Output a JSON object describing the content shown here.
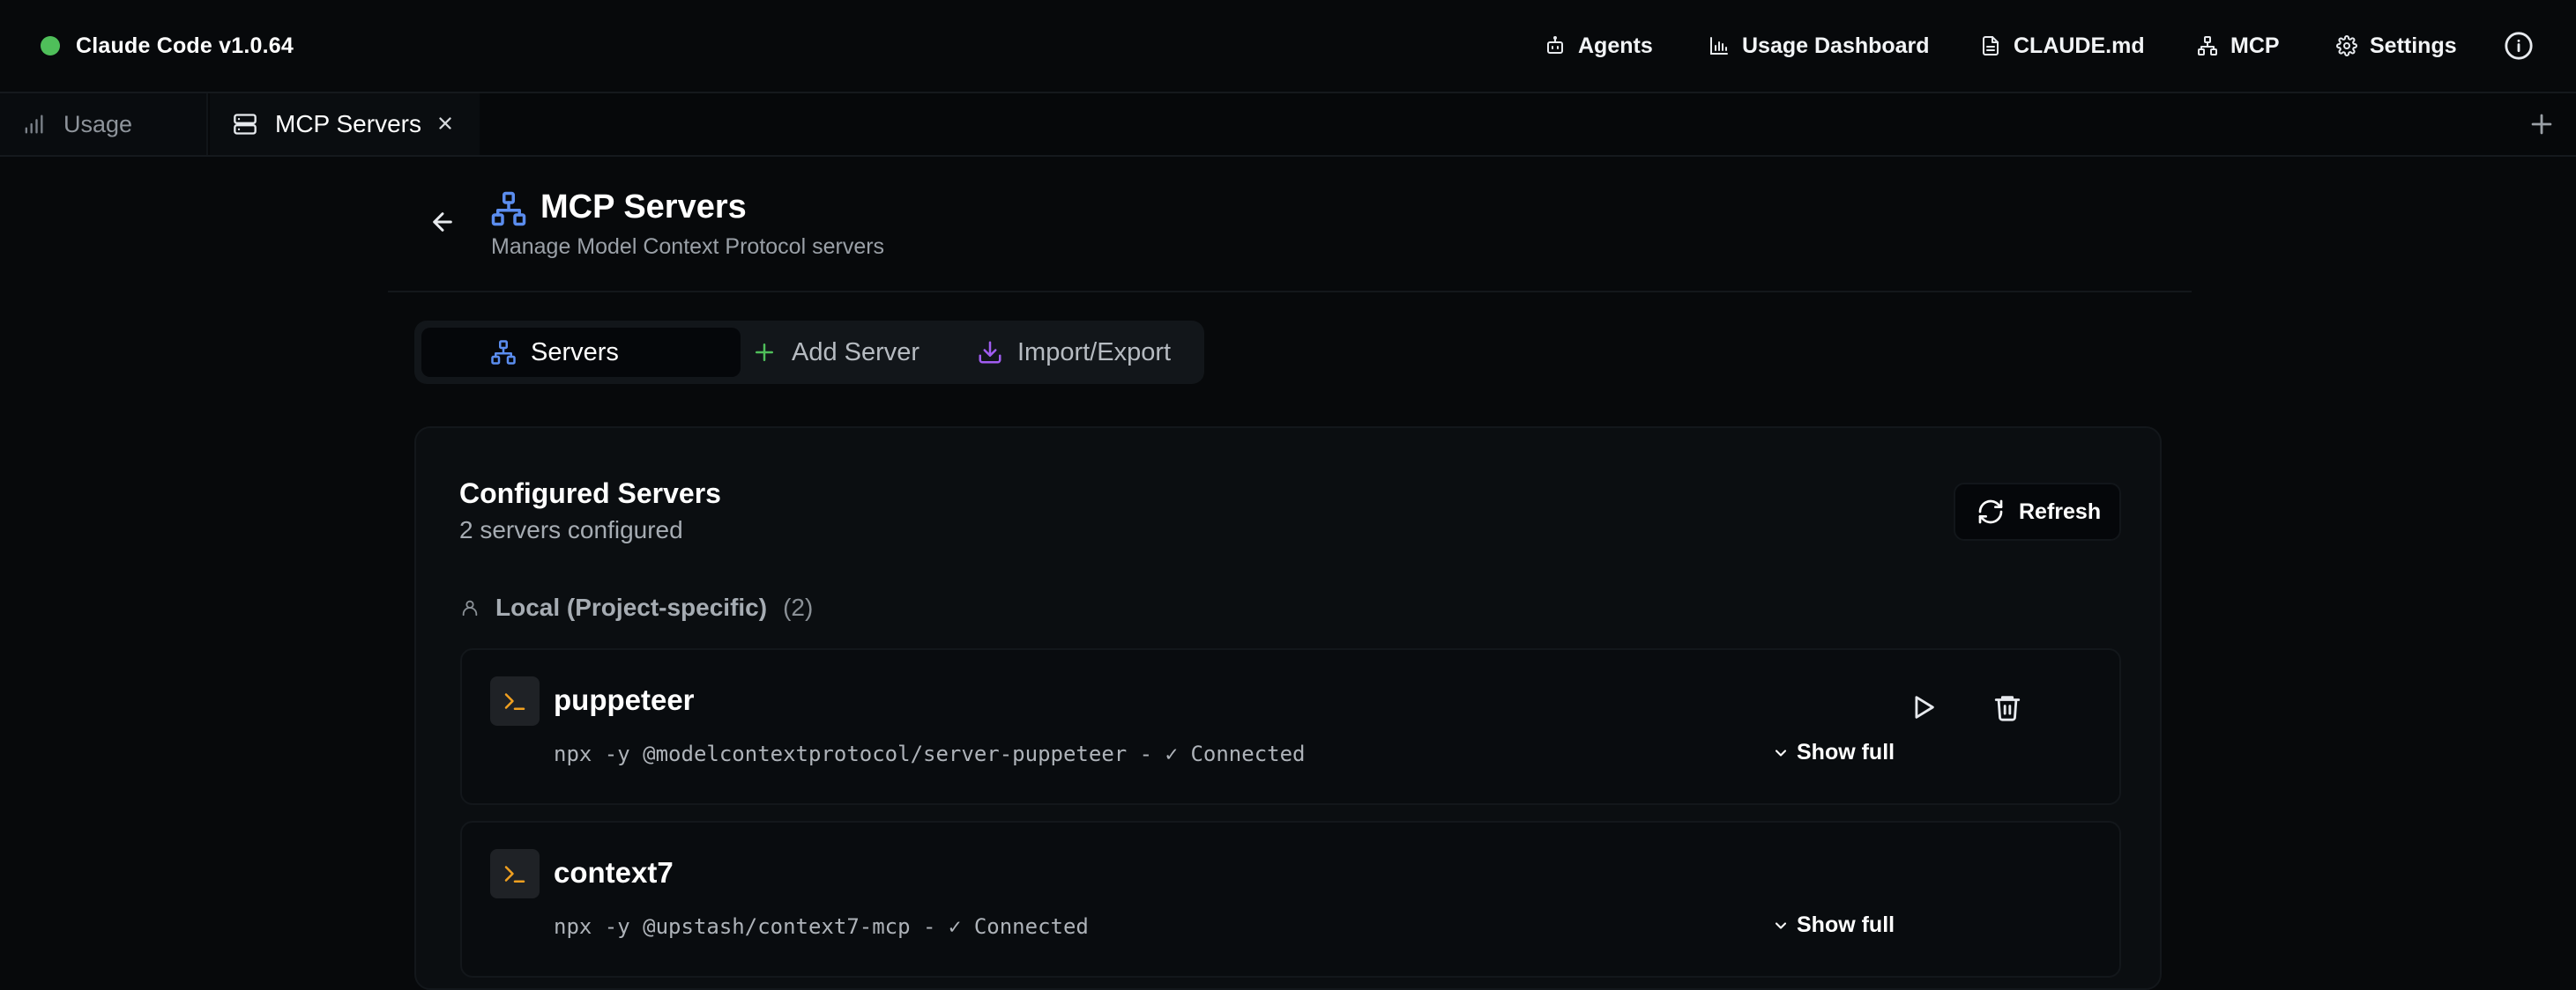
{
  "app": {
    "title": "Claude Code v1.0.64",
    "status_color": "#4fbf5a"
  },
  "nav": {
    "agents": "Agents",
    "usage_dashboard": "Usage Dashboard",
    "claude_md": "CLAUDE.md",
    "mcp": "MCP",
    "settings": "Settings"
  },
  "tabs": [
    {
      "label": "Usage",
      "icon": "bar-chart-icon",
      "active": false
    },
    {
      "label": "MCP Servers",
      "icon": "server-icon",
      "active": true
    }
  ],
  "page": {
    "title": "MCP Servers",
    "subtitle": "Manage Model Context Protocol servers",
    "icon": "network-icon",
    "accent_color": "#5b8def"
  },
  "segments": {
    "servers": "Servers",
    "add_server": "Add Server",
    "import_export": "Import/Export"
  },
  "configured": {
    "title": "Configured Servers",
    "count_text": "2 servers configured",
    "refresh": "Refresh"
  },
  "groups": [
    {
      "name": "Local (Project-specific)",
      "count": "(2)"
    }
  ],
  "servers": [
    {
      "name": "puppeteer",
      "command": "npx -y @modelcontextprotocol/server-puppeteer - ✓ Connected",
      "show_full": "Show full"
    },
    {
      "name": "context7",
      "command": "npx -y @upstash/context7-mcp - ✓ Connected",
      "show_full": "Show full"
    }
  ]
}
